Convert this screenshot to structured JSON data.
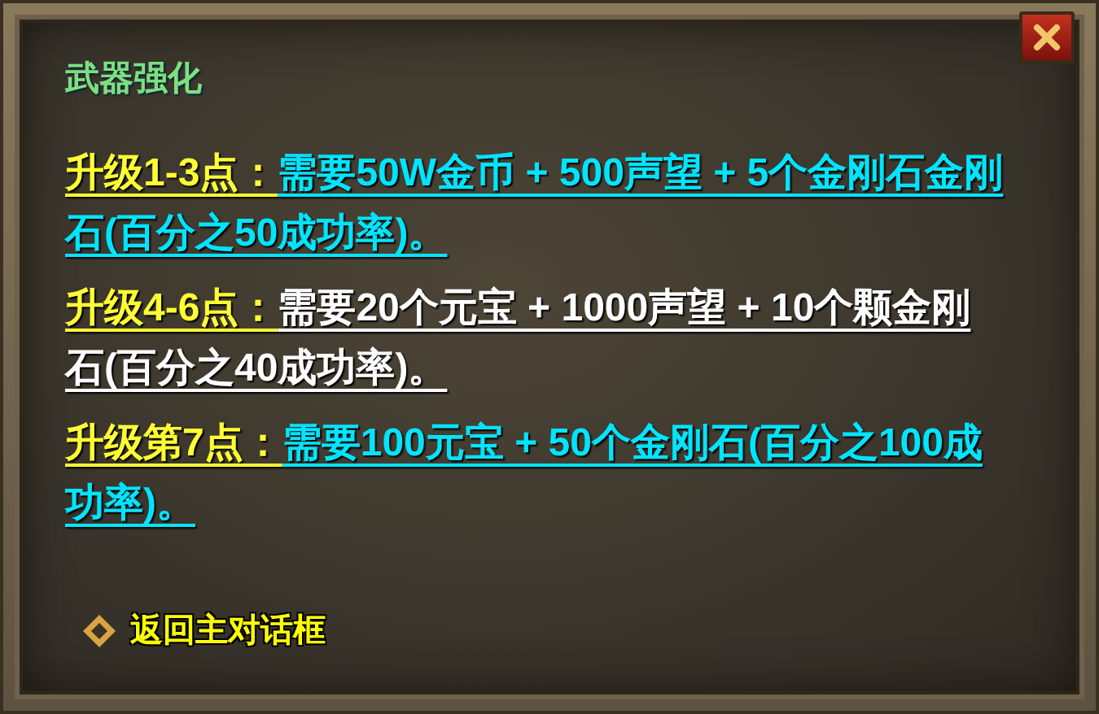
{
  "dialog": {
    "title": "武器强化",
    "items": [
      {
        "label": "升级1-3点：",
        "description": "需要50W金币 + 500声望 + 5个金刚石金刚石(百分之50成功率)。",
        "color": "#00e5ff"
      },
      {
        "label": "升级4-6点：",
        "description": "需要20个元宝 + 1000声望 + 10个颗金刚石(百分之40成功率)。",
        "color": "#ffffff"
      },
      {
        "label": "升级第7点：",
        "description": "需要100元宝 + 50个金刚石(百分之100成功率)。",
        "color": "#00e5ff"
      }
    ],
    "back_link": "返回主对话框"
  }
}
